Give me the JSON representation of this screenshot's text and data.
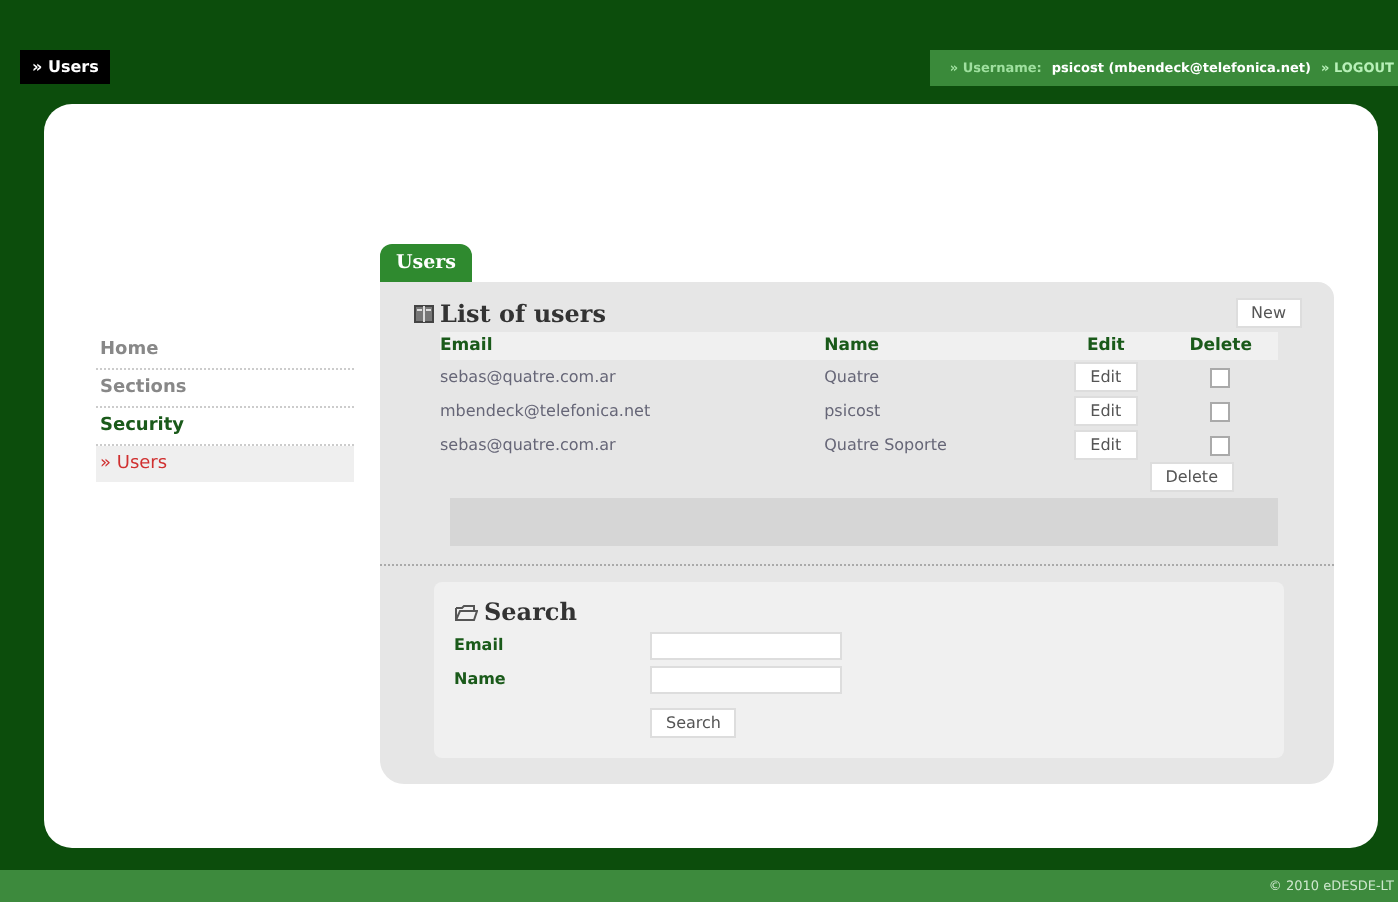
{
  "header": {
    "section": "» Users",
    "username_label": "» Username:",
    "username": "psicost (mbendeck@telefonica.net)",
    "logout": "» LOGOUT"
  },
  "sidebar": {
    "items": [
      {
        "label": "Home",
        "selected": false,
        "kind": "main"
      },
      {
        "label": "Sections",
        "selected": false,
        "kind": "main"
      },
      {
        "label": "Security",
        "selected": true,
        "kind": "main"
      },
      {
        "label": "» Users",
        "selected": true,
        "kind": "sub"
      }
    ]
  },
  "tab": {
    "label": "Users"
  },
  "list": {
    "title": "List of users",
    "new_button": "New",
    "columns": [
      "Email",
      "Name",
      "Edit",
      "Delete"
    ],
    "rows": [
      {
        "email": "sebas@quatre.com.ar",
        "name": "Quatre",
        "edit": "Edit",
        "checked": false
      },
      {
        "email": "mbendeck@telefonica.net",
        "name": "psicost",
        "edit": "Edit",
        "checked": false
      },
      {
        "email": "sebas@quatre.com.ar",
        "name": "Quatre Soporte",
        "edit": "Edit",
        "checked": false
      }
    ],
    "delete_button": "Delete"
  },
  "search": {
    "title": "Search",
    "fields": [
      {
        "label": "Email"
      },
      {
        "label": "Name"
      }
    ],
    "button": "Search"
  },
  "footer": "© 2010 eDESDE-LT"
}
